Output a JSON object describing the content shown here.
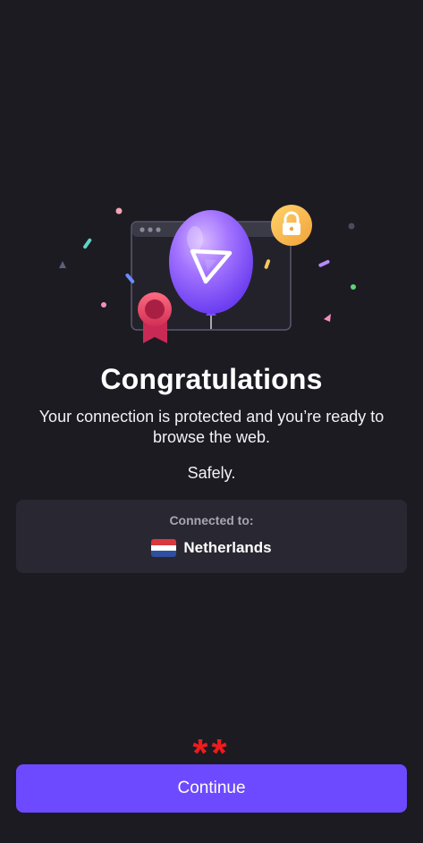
{
  "congrats": {
    "title": "Congratulations",
    "subtitle": "Your connection is protected and you’re ready to browse the web.",
    "tagline": "Safely."
  },
  "connection": {
    "label": "Connected to:",
    "country": "Netherlands",
    "flag_icon": "netherlands-flag-icon"
  },
  "annotation": {
    "marker": "**"
  },
  "actions": {
    "continue_label": "Continue"
  },
  "colors": {
    "background": "#1c1b22",
    "card": "#292832",
    "primary": "#6d4aff",
    "balloon": "#8b5cf6",
    "lock_badge": "#f6b93b",
    "ribbon": "#e2435d",
    "annotation": "#ee1c1c"
  }
}
